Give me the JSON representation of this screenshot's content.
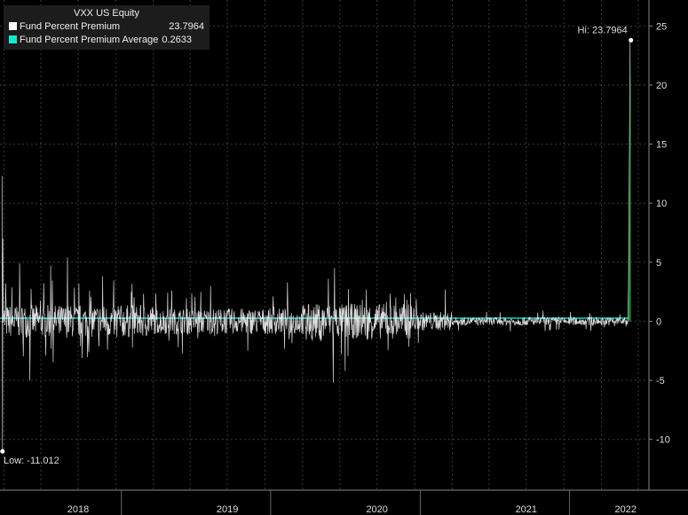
{
  "chart_data": {
    "type": "line",
    "title": "VXX US Equity",
    "x_ticks": [
      "2018",
      "2019",
      "2020",
      "2021",
      "2022"
    ],
    "y_ticks": [
      25,
      20,
      15,
      10,
      5,
      0,
      -5,
      -10
    ],
    "ylim": [
      -14.3,
      27.2
    ],
    "grid": true,
    "legend_position": "top-left",
    "series": [
      {
        "name": "Fund Percent Premium",
        "color": "#ffffff",
        "last_value": "23.7964",
        "description": "daily premium noise around 0, large swings in 2018 and 2020, quiet 2021, spike at end of series",
        "points": [
          [
            "2017-12-27",
            12.3
          ],
          [
            "2017-12-28",
            -11.012
          ],
          [
            "2017-12-29",
            7.0
          ],
          [
            "2018-01-05",
            3.2
          ],
          [
            "2018-02-08",
            4.9
          ],
          [
            "2018-03-05",
            -5.0
          ],
          [
            "2018-04-25",
            4.7
          ],
          [
            "2018-06-05",
            5.4
          ],
          [
            "2018-08-30",
            3.8
          ],
          [
            "2018-11-08",
            2.5
          ],
          [
            "2019-02-15",
            2.6
          ],
          [
            "2019-05-21",
            3.0
          ],
          [
            "2019-08-20",
            -2.5
          ],
          [
            "2019-11-25",
            3.3
          ],
          [
            "2020-03-04",
            3.6
          ],
          [
            "2020-03-16",
            -5.2
          ],
          [
            "2020-03-19",
            4.5
          ],
          [
            "2020-04-14",
            -4.2
          ],
          [
            "2020-09-21",
            2.4
          ],
          [
            "2020-12-15",
            2.7
          ],
          [
            "2021-03-26",
            0.8
          ],
          [
            "2021-08-11",
            0.9
          ],
          [
            "2021-12-03",
            0.7
          ],
          [
            "2022-02-15",
            0.6
          ],
          [
            "2022-03-08",
            3.0
          ],
          [
            "2022-03-12",
            18.5
          ],
          [
            "2022-03-14",
            23.7964
          ]
        ]
      },
      {
        "name": "Fund Percent Premium Average",
        "color": "#19e6d2",
        "value": "0.2633"
      }
    ],
    "annotations": {
      "high": {
        "label": "Hi: 23.7964",
        "date": "2022-03-14",
        "value": 23.7964
      },
      "low": {
        "label": "Low: -11.012",
        "date": "2017-12-28",
        "value": -11.012
      }
    }
  }
}
